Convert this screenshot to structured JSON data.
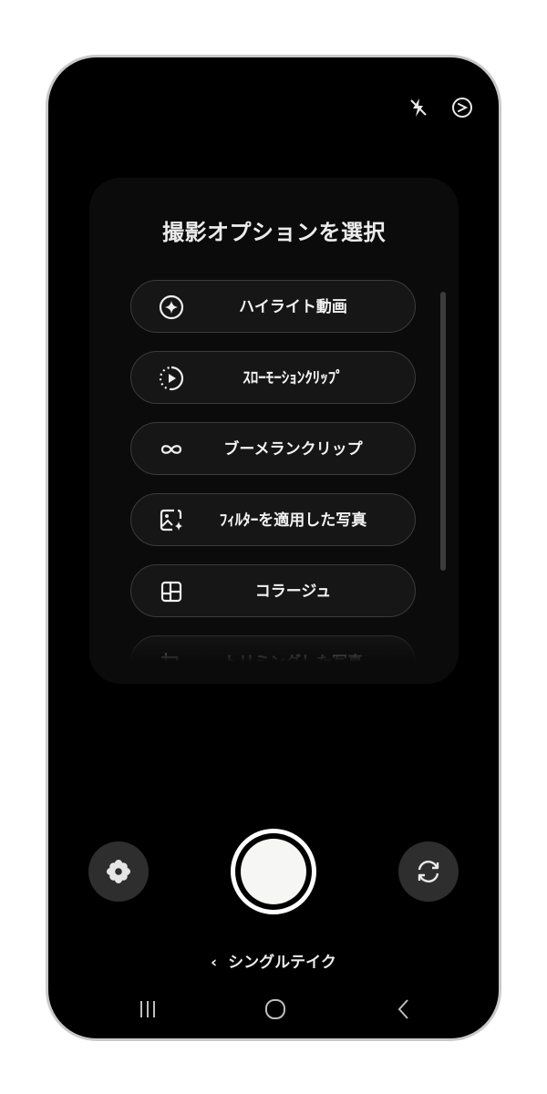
{
  "status_icons": {
    "flash": "flash-off-icon",
    "timer": "timer-icon"
  },
  "menu": {
    "title": "撮影オプションを選択",
    "options": [
      {
        "label": "ハイライト動画",
        "icon": "sparkle-circle-icon"
      },
      {
        "label": "ｽﾛｰﾓｰｼｮﾝｸﾘｯﾌﾟ",
        "icon": "play-circle-icon"
      },
      {
        "label": "ブーメランクリップ",
        "icon": "infinity-icon"
      },
      {
        "label": "ﾌｨﾙﾀｰを適用した写真",
        "icon": "image-sparkle-icon"
      },
      {
        "label": "コラージュ",
        "icon": "collage-icon"
      },
      {
        "label": "トリミングした写真",
        "icon": "crop-icon"
      }
    ]
  },
  "controls": {
    "left": "flower-icon",
    "shutter": "shutter-button",
    "right": "switch-camera-icon"
  },
  "mode": {
    "chevron": "‹",
    "label": "シングルテイク"
  },
  "navbar": {
    "recent": "recents-icon",
    "home": "home-icon",
    "back": "back-icon"
  },
  "colors": {
    "background": "#000000",
    "panel": "#0b0b0b",
    "option_bg": "#161616",
    "option_border": "#3b3b3b",
    "text": "#f2f2f2"
  }
}
